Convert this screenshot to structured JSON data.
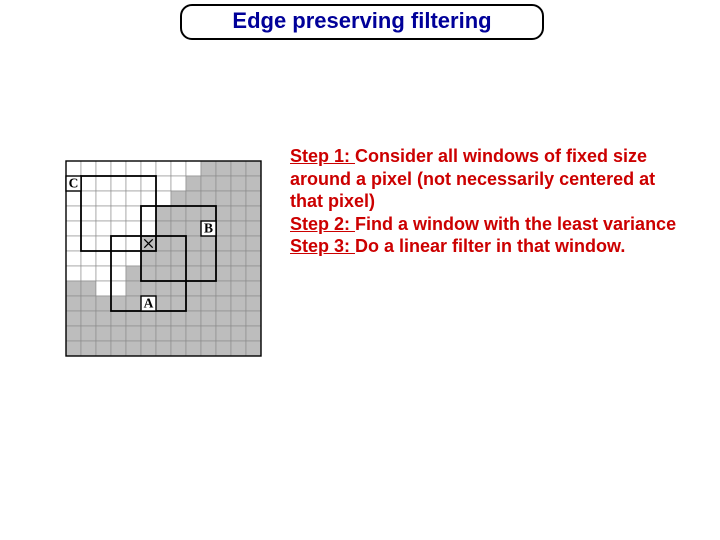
{
  "title": "Edge preserving filtering",
  "steps": {
    "s1_label": "Step 1: ",
    "s1_text": "Consider all windows of fixed size around a pixel (not necessarily centered at that pixel)",
    "s2_label": "Step 2: ",
    "s2_text": "Find a window with the least variance",
    "s3_label": "Step 3: ",
    "s3_text": "Do a linear filter in that window."
  },
  "diagram": {
    "grid_size": 13,
    "cell": 15,
    "center": {
      "row": 5,
      "col": 5
    },
    "windows": [
      {
        "name": "A",
        "row0": 5,
        "col0": 3,
        "label_row": 9,
        "label_col": 5
      },
      {
        "name": "B",
        "row0": 3,
        "col0": 5,
        "label_row": 4,
        "label_col": 9
      },
      {
        "name": "C",
        "row0": 1,
        "col0": 1,
        "label_row": 1,
        "label_col": 0
      }
    ],
    "gray_cells": [
      [
        0,
        9
      ],
      [
        0,
        10
      ],
      [
        0,
        11
      ],
      [
        0,
        12
      ],
      [
        1,
        8
      ],
      [
        1,
        9
      ],
      [
        1,
        10
      ],
      [
        1,
        11
      ],
      [
        1,
        12
      ],
      [
        2,
        7
      ],
      [
        2,
        8
      ],
      [
        2,
        9
      ],
      [
        2,
        10
      ],
      [
        2,
        11
      ],
      [
        2,
        12
      ],
      [
        3,
        6
      ],
      [
        3,
        7
      ],
      [
        3,
        8
      ],
      [
        3,
        9
      ],
      [
        3,
        10
      ],
      [
        3,
        11
      ],
      [
        3,
        12
      ],
      [
        4,
        6
      ],
      [
        4,
        7
      ],
      [
        4,
        8
      ],
      [
        4,
        9
      ],
      [
        4,
        10
      ],
      [
        4,
        11
      ],
      [
        4,
        12
      ],
      [
        5,
        5
      ],
      [
        5,
        6
      ],
      [
        5,
        7
      ],
      [
        5,
        8
      ],
      [
        5,
        9
      ],
      [
        5,
        10
      ],
      [
        5,
        11
      ],
      [
        5,
        12
      ],
      [
        6,
        5
      ],
      [
        6,
        6
      ],
      [
        6,
        7
      ],
      [
        6,
        8
      ],
      [
        6,
        9
      ],
      [
        6,
        10
      ],
      [
        6,
        11
      ],
      [
        6,
        12
      ],
      [
        7,
        4
      ],
      [
        7,
        5
      ],
      [
        7,
        6
      ],
      [
        7,
        7
      ],
      [
        7,
        8
      ],
      [
        7,
        9
      ],
      [
        7,
        10
      ],
      [
        7,
        11
      ],
      [
        7,
        12
      ],
      [
        8,
        0
      ],
      [
        8,
        1
      ],
      [
        8,
        4
      ],
      [
        8,
        5
      ],
      [
        8,
        6
      ],
      [
        8,
        7
      ],
      [
        8,
        8
      ],
      [
        8,
        9
      ],
      [
        8,
        10
      ],
      [
        8,
        11
      ],
      [
        8,
        12
      ],
      [
        9,
        0
      ],
      [
        9,
        1
      ],
      [
        9,
        2
      ],
      [
        9,
        3
      ],
      [
        9,
        4
      ],
      [
        9,
        5
      ],
      [
        9,
        6
      ],
      [
        9,
        7
      ],
      [
        9,
        8
      ],
      [
        9,
        9
      ],
      [
        9,
        10
      ],
      [
        9,
        11
      ],
      [
        9,
        12
      ],
      [
        10,
        0
      ],
      [
        10,
        1
      ],
      [
        10,
        2
      ],
      [
        10,
        3
      ],
      [
        10,
        4
      ],
      [
        10,
        5
      ],
      [
        10,
        6
      ],
      [
        10,
        7
      ],
      [
        10,
        8
      ],
      [
        10,
        9
      ],
      [
        10,
        10
      ],
      [
        10,
        11
      ],
      [
        10,
        12
      ],
      [
        11,
        0
      ],
      [
        11,
        1
      ],
      [
        11,
        2
      ],
      [
        11,
        3
      ],
      [
        11,
        4
      ],
      [
        11,
        5
      ],
      [
        11,
        6
      ],
      [
        11,
        7
      ],
      [
        11,
        8
      ],
      [
        11,
        9
      ],
      [
        11,
        10
      ],
      [
        11,
        11
      ],
      [
        11,
        12
      ],
      [
        12,
        0
      ],
      [
        12,
        1
      ],
      [
        12,
        2
      ],
      [
        12,
        3
      ],
      [
        12,
        4
      ],
      [
        12,
        5
      ],
      [
        12,
        6
      ],
      [
        12,
        7
      ],
      [
        12,
        8
      ],
      [
        12,
        9
      ],
      [
        12,
        10
      ],
      [
        12,
        11
      ],
      [
        12,
        12
      ]
    ]
  }
}
